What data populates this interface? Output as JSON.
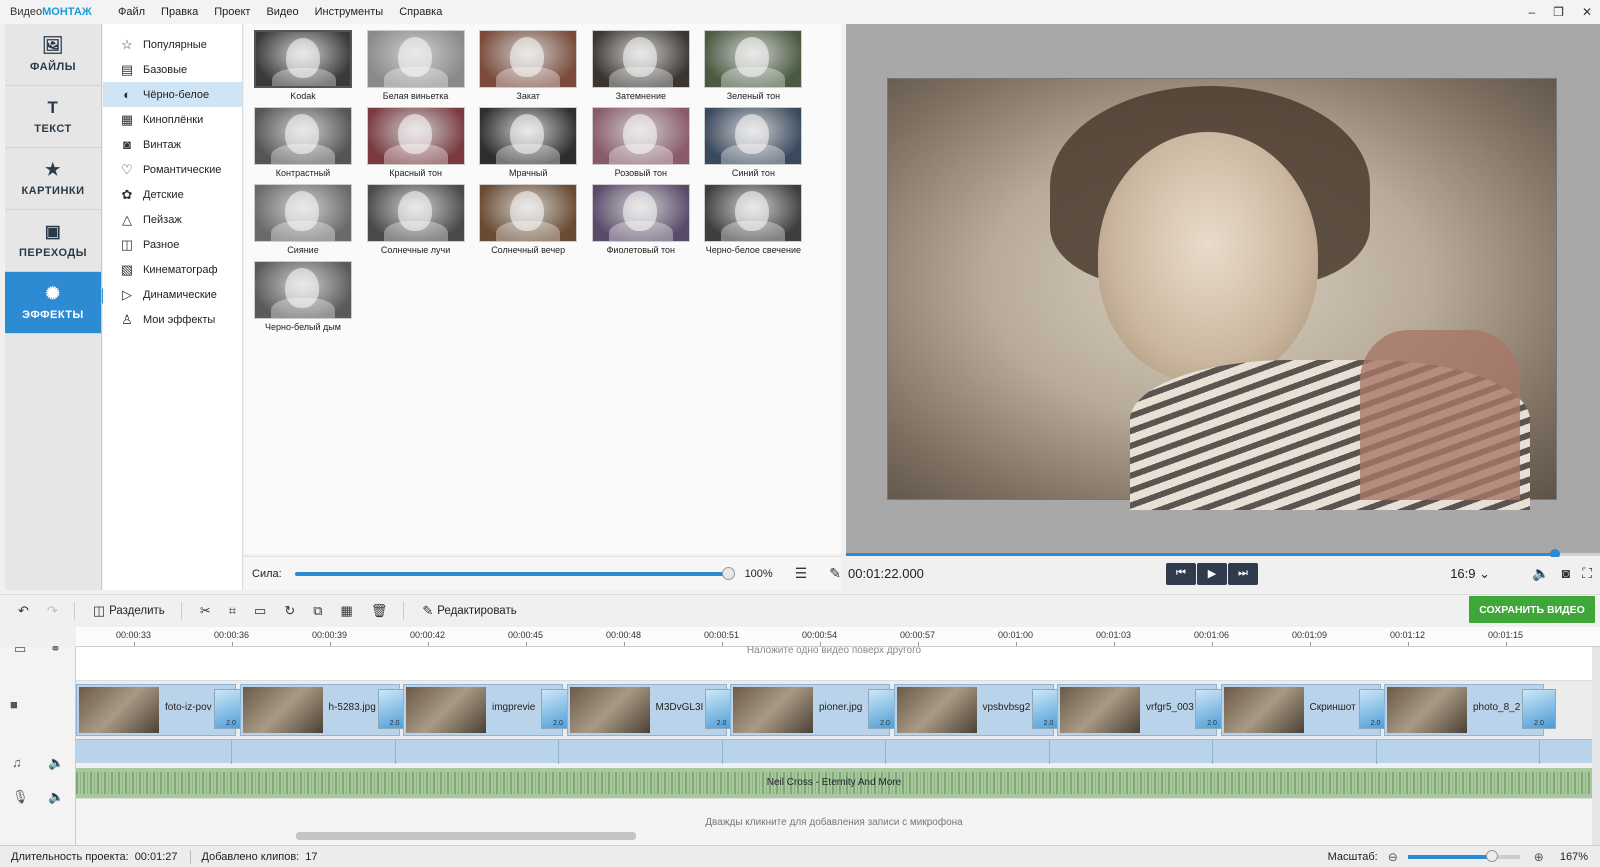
{
  "app": {
    "logo_prefix": "Видео",
    "logo_brand": "МОНТАЖ",
    "menu": [
      "Файл",
      "Правка",
      "Проект",
      "Видео",
      "Инструменты",
      "Справка"
    ],
    "window_controls": [
      "–",
      "❐",
      "✕"
    ]
  },
  "left_tabs": [
    {
      "label": "ФАЙЛЫ",
      "icon": "image-icon",
      "glyph": "🖼",
      "active": false
    },
    {
      "label": "ТЕКСТ",
      "icon": "text-icon",
      "glyph": "T",
      "active": false
    },
    {
      "label": "КАРТИНКИ",
      "icon": "star-icon",
      "glyph": "★",
      "active": false
    },
    {
      "label": "ПЕРЕХОДЫ",
      "icon": "transitions-icon",
      "glyph": "▣",
      "active": false
    },
    {
      "label": "ЭФФЕКТЫ",
      "icon": "effects-icon",
      "glyph": "✺",
      "active": true
    }
  ],
  "categories": [
    {
      "label": "Популярные",
      "glyph": "☆",
      "icon": "star-outline-icon"
    },
    {
      "label": "Базовые",
      "glyph": "▤",
      "icon": "basic-icon"
    },
    {
      "label": "Чёрно-белое",
      "glyph": "◐",
      "icon": "bw-icon",
      "active": true
    },
    {
      "label": "Киноплёнки",
      "glyph": "▦",
      "icon": "film-icon"
    },
    {
      "label": "Винтаж",
      "glyph": "◙",
      "icon": "camera-icon"
    },
    {
      "label": "Романтические",
      "glyph": "♡",
      "icon": "heart-icon"
    },
    {
      "label": "Детские",
      "glyph": "✿",
      "icon": "kids-icon"
    },
    {
      "label": "Пейзаж",
      "glyph": "△",
      "icon": "landscape-icon"
    },
    {
      "label": "Разное",
      "glyph": "◫",
      "icon": "misc-icon"
    },
    {
      "label": "Кинематограф",
      "glyph": "▧",
      "icon": "cinema-icon"
    },
    {
      "label": "Динамические",
      "glyph": "▷",
      "icon": "dynamic-icon"
    },
    {
      "label": "Мои эффекты",
      "glyph": "♙",
      "icon": "user-icon"
    }
  ],
  "effects": [
    {
      "label": "Kodak",
      "tint": "#3a3a3a",
      "selected": true
    },
    {
      "label": "Белая виньетка",
      "tint": "#8a8a8a"
    },
    {
      "label": "Закат",
      "tint": "#7a4a3a"
    },
    {
      "label": "Затемнение",
      "tint": "#3a3530"
    },
    {
      "label": "Зеленый тон",
      "tint": "#4a5a40"
    },
    {
      "label": "Контрастный",
      "tint": "#555555"
    },
    {
      "label": "Красный тон",
      "tint": "#7a3a40"
    },
    {
      "label": "Мрачный",
      "tint": "#2e2e2e"
    },
    {
      "label": "Розовый тон",
      "tint": "#8a5a6a"
    },
    {
      "label": "Синий тон",
      "tint": "#3a4a5e"
    },
    {
      "label": "Сияние",
      "tint": "#6a6a6a"
    },
    {
      "label": "Солнечные лучи",
      "tint": "#4a4a4a"
    },
    {
      "label": "Солнечный вечер",
      "tint": "#6a4a30"
    },
    {
      "label": "Фиолетовый тон",
      "tint": "#5a4a6a"
    },
    {
      "label": "Черно-белое свечение",
      "tint": "#3e3e3e"
    },
    {
      "label": "Черно-белый дым",
      "tint": "#5a5a5a"
    }
  ],
  "strength": {
    "label": "Сила:",
    "value_text": "100%",
    "value": 1.0
  },
  "preview": {
    "timecode": "00:01:22.000",
    "aspect": "16:9 ⌄",
    "progress": 0.94
  },
  "toolbar": {
    "split_label": "Разделить",
    "edit_label": "Редактировать",
    "save_label": "СОХРАНИТЬ ВИДЕО"
  },
  "ruler": [
    "00:00:33",
    "00:00:36",
    "00:00:39",
    "00:00:42",
    "00:00:45",
    "00:00:48",
    "00:00:51",
    "00:00:54",
    "00:00:57",
    "00:01:00",
    "00:01:03",
    "00:01:06",
    "00:01:09",
    "00:01:12",
    "00:01:15"
  ],
  "timeline": {
    "overlay_hint": "Наложите одно видео поверх другого",
    "clips": [
      "foto-iz-pov",
      "h-5283.jpg",
      "imgprevie",
      "M3DvGL3I",
      "pioner.jpg",
      "vpsbvbsg2",
      "vrfgr5_003",
      "Скриншот",
      "photo_8_2"
    ],
    "transition_value": "2.0",
    "audio_track": "Neil Cross - Eternity And More",
    "mic_hint": "Дважды кликните для добавления записи с микрофона"
  },
  "status": {
    "duration_label": "Длительность проекта:",
    "duration_value": "00:01:27",
    "clips_label": "Добавлено клипов:",
    "clips_value": "17",
    "zoom_label": "Масштаб:",
    "zoom_value": "167%",
    "zoom_level": 0.75
  }
}
